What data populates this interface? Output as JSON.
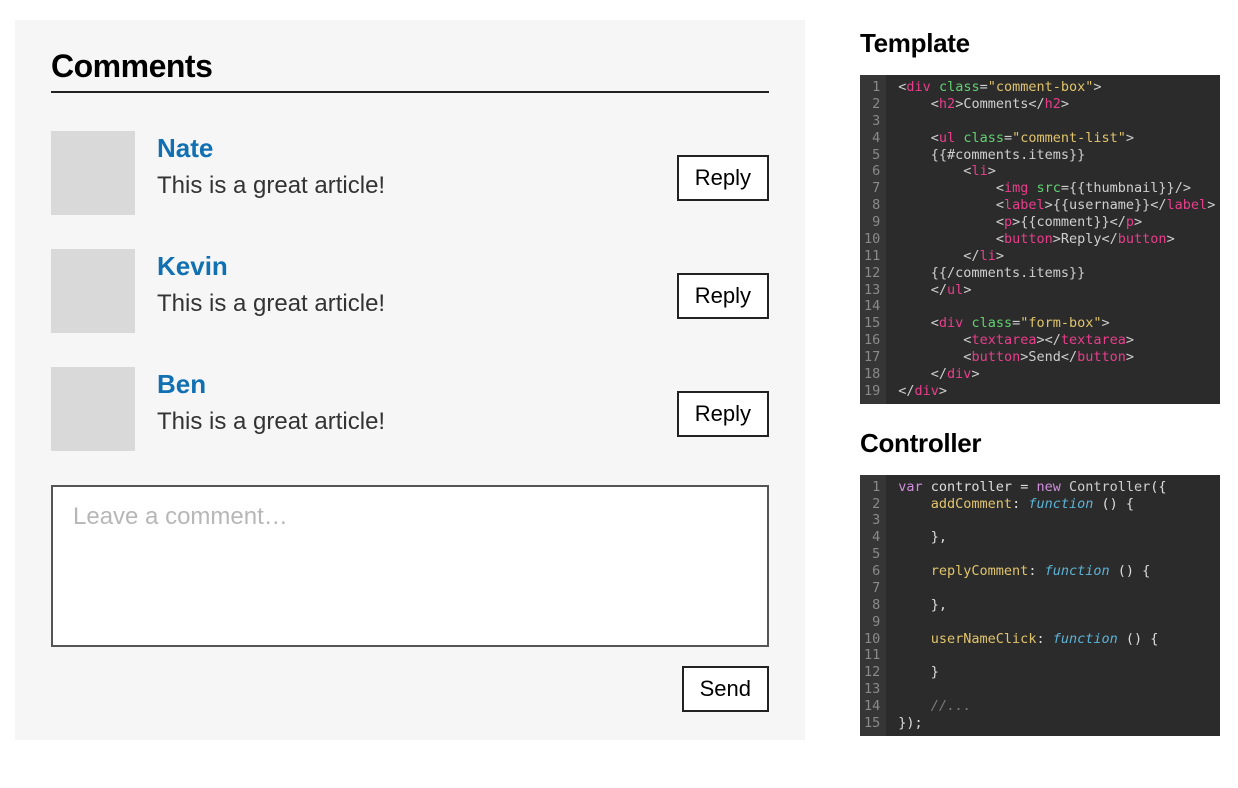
{
  "comment_box": {
    "title": "Comments",
    "items": [
      {
        "username": "Nate",
        "comment": "This is a great article!",
        "reply_label": "Reply"
      },
      {
        "username": "Kevin",
        "comment": "This is a great article!",
        "reply_label": "Reply"
      },
      {
        "username": "Ben",
        "comment": "This is a great article!",
        "reply_label": "Reply"
      }
    ],
    "textarea_placeholder": "Leave a comment…",
    "send_label": "Send"
  },
  "side": {
    "template_heading": "Template",
    "controller_heading": "Controller",
    "template_code": {
      "line_count": 19,
      "lines": [
        "<div class=\"comment-box\">",
        "    <h2>Comments</h2>",
        "",
        "    <ul class=\"comment-list\">",
        "    {{#comments.items}}",
        "        <li>",
        "            <img src={{thumbnail}}/>",
        "            <label>{{username}}</label>",
        "            <p>{{comment}}</p>",
        "            <button>Reply</button>",
        "        </li>",
        "    {{/comments.items}}",
        "    </ul>",
        "",
        "    <div class=\"form-box\">",
        "        <textarea></textarea>",
        "        <button>Send</button>",
        "    </div>",
        "</div>"
      ]
    },
    "controller_code": {
      "line_count": 15,
      "lines": [
        "var controller = new Controller({",
        "    addComment: function () {",
        "",
        "    },",
        "",
        "    replyComment: function () {",
        "",
        "    },",
        "",
        "    userNameClick: function () {",
        "",
        "    }",
        "",
        "    //...",
        "});"
      ]
    }
  }
}
